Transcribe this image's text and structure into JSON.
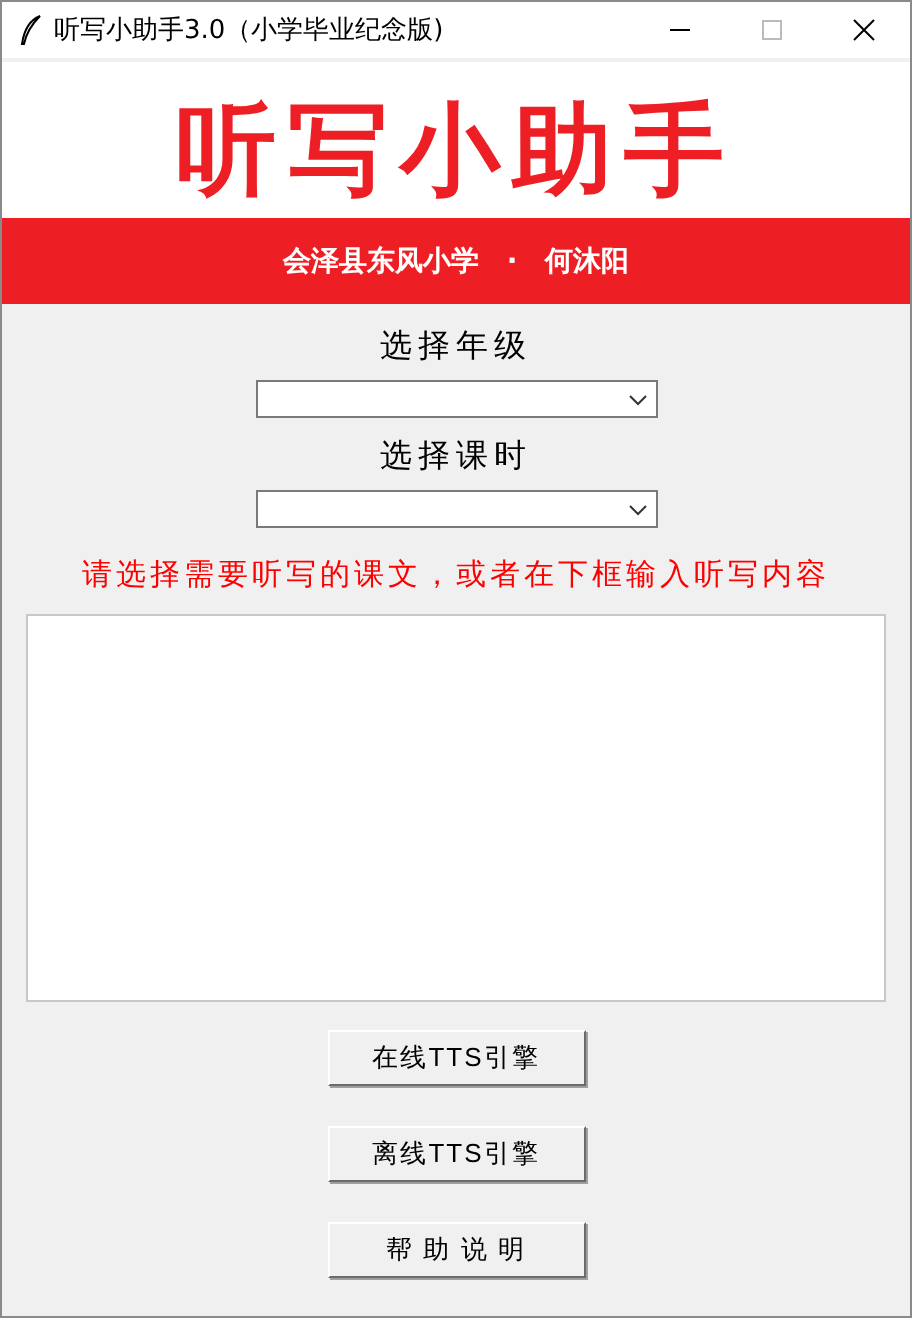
{
  "window": {
    "title": "听写小助手3.0（小学毕业纪念版)"
  },
  "banner": {
    "title": "听写小助手",
    "subtitle": "会泽县东风小学　·　何沐阳"
  },
  "selectors": [
    {
      "label": "选择年级"
    },
    {
      "label": "选择课时"
    }
  ],
  "instruction": "请选择需要听写的课文，或者在下框输入听写内容",
  "buttons": [
    "在线TTS引擎",
    "离线TTS引擎",
    "帮 助 说 明"
  ]
}
